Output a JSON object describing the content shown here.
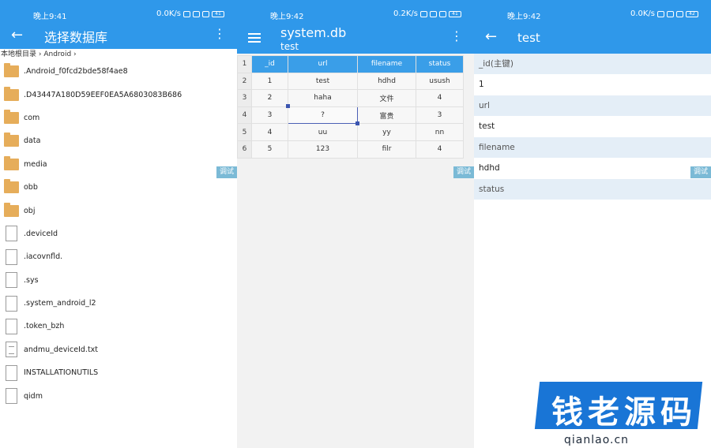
{
  "panel1": {
    "status": {
      "time": "晚上9:41",
      "speed": "0.0K/s",
      "battery": "41"
    },
    "title": "选择数据库",
    "breadcrumb": [
      "本地根目录",
      "Android"
    ],
    "files": [
      {
        "name": ".Android_f0fcd2bde58f4ae8",
        "type": "folder"
      },
      {
        "name": ".D43447A180D59EEF0EA5A6803083B686",
        "type": "folder"
      },
      {
        "name": "com",
        "type": "folder"
      },
      {
        "name": "data",
        "type": "folder"
      },
      {
        "name": "media",
        "type": "folder"
      },
      {
        "name": "obb",
        "type": "folder"
      },
      {
        "name": "obj",
        "type": "folder"
      },
      {
        "name": ".deviceId",
        "type": "file"
      },
      {
        "name": ".iacovnfld.",
        "type": "file"
      },
      {
        "name": ".sys",
        "type": "file"
      },
      {
        "name": ".system_android_l2",
        "type": "file"
      },
      {
        "name": ".token_bzh",
        "type": "file"
      },
      {
        "name": "andmu_deviceId.txt",
        "type": "text"
      },
      {
        "name": "INSTALLATIONUTILS",
        "type": "file"
      },
      {
        "name": "qidm",
        "type": "file"
      }
    ],
    "debug_label": "调试"
  },
  "panel2": {
    "status": {
      "time": "晚上9:42",
      "speed": "0.2K/s",
      "battery": "41"
    },
    "title": "system.db",
    "subtitle": "test",
    "columns": [
      "_id",
      "url",
      "filename",
      "status"
    ],
    "header_rownum": "1",
    "rows": [
      {
        "n": "2",
        "cells": [
          "1",
          "test",
          "hdhd",
          "usush"
        ]
      },
      {
        "n": "3",
        "cells": [
          "2",
          "haha",
          "文件",
          "4"
        ]
      },
      {
        "n": "4",
        "cells": [
          "3",
          "?",
          "富贵",
          "3"
        ]
      },
      {
        "n": "5",
        "cells": [
          "4",
          "uu",
          "yy",
          "nn"
        ]
      },
      {
        "n": "6",
        "cells": [
          "5",
          "123",
          "filr",
          "4"
        ]
      }
    ],
    "debug_label": "调试"
  },
  "panel3": {
    "status": {
      "time": "晚上9:42",
      "speed": "0.0K/s",
      "battery": "42"
    },
    "title": "test",
    "fields": [
      {
        "label": "_id(主键)",
        "value": "1"
      },
      {
        "label": "url",
        "value": "test"
      },
      {
        "label": "filename",
        "value": "hdhd"
      },
      {
        "label": "status",
        "value": ""
      }
    ],
    "debug_label": "调试"
  },
  "watermark": {
    "text": "钱老源码",
    "url": "qianlao.cn"
  },
  "colors": {
    "primary": "#2f98ea",
    "header": "#3a9ee8",
    "folder": "#e6ad5a",
    "badge": "#7bbad6",
    "watermark": "#1975d6"
  }
}
